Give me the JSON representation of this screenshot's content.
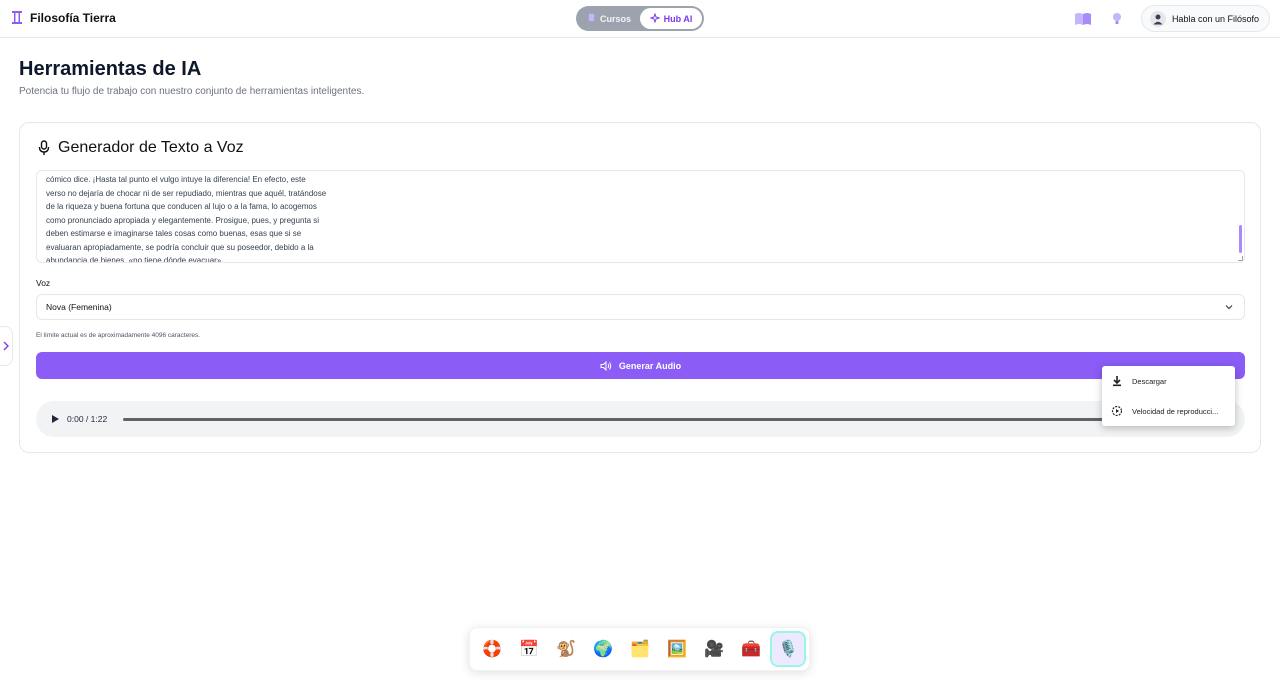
{
  "topbar": {
    "brand": "Filosofía Tierra",
    "tabs": [
      {
        "label": "Cursos",
        "active": false
      },
      {
        "label": "Hub AI",
        "active": true
      }
    ],
    "talk_button": "Habla con un Filósofo",
    "icons": [
      "book-open-icon",
      "lightbulb-icon"
    ]
  },
  "page": {
    "title": "Herramientas de IA",
    "subtitle": "Potencia tu flujo de trabajo con nuestro conjunto de herramientas inteligentes."
  },
  "tts": {
    "title": "Generador de Texto a Voz",
    "text_lines": [
      "cómico dice. ¡Hasta tal punto el vulgo intuye la diferencia! En efecto, este",
      "verso no dejaría de chocar ni de ser repudiado, mientras que aquél, tratándose",
      "de la riqueza y buena fortuna que conducen al lujo o a la fama, lo acogemos",
      "como pronunciado apropiada y elegantemente. Prosigue, pues, y pregunta si",
      "deben estimarse e imaginarse tales cosas como buenas, esas que si se",
      "evaluaran apropiadamente, se podría concluir que su poseedor, debido a la",
      "abundancia de bienes, «no tiene dónde evacuar»."
    ],
    "voice_label": "Voz",
    "voice_selected": "Nova (Femenina)",
    "limit_note": "El límite actual es de aproximadamente 4096 caracteres.",
    "generate_button": "Generar Audio"
  },
  "player": {
    "time": "0:00 / 1:22",
    "menu": [
      {
        "label": "Descargar",
        "icon": "download-icon"
      },
      {
        "label": "Velocidad de reproducci...",
        "icon": "playback-speed-icon"
      }
    ]
  },
  "dock": {
    "items": [
      {
        "name": "lifebuoy-tool",
        "icon": "🛟"
      },
      {
        "name": "calendar-tool",
        "icon": "📅"
      },
      {
        "name": "monkey-tool",
        "icon": "🐒"
      },
      {
        "name": "globe-tool",
        "icon": "🌍"
      },
      {
        "name": "folder-tool",
        "icon": "🗂️"
      },
      {
        "name": "image-tool",
        "icon": "🖼️"
      },
      {
        "name": "camera-tool",
        "icon": "🎥"
      },
      {
        "name": "toolbox-tool",
        "icon": "🧰"
      },
      {
        "name": "microphone-tool",
        "icon": "🎙️",
        "active": true
      }
    ]
  },
  "colors": {
    "accent": "#8b5cf6",
    "accent_text": "#7c3aed",
    "segment_bg": "#9ca3af"
  }
}
